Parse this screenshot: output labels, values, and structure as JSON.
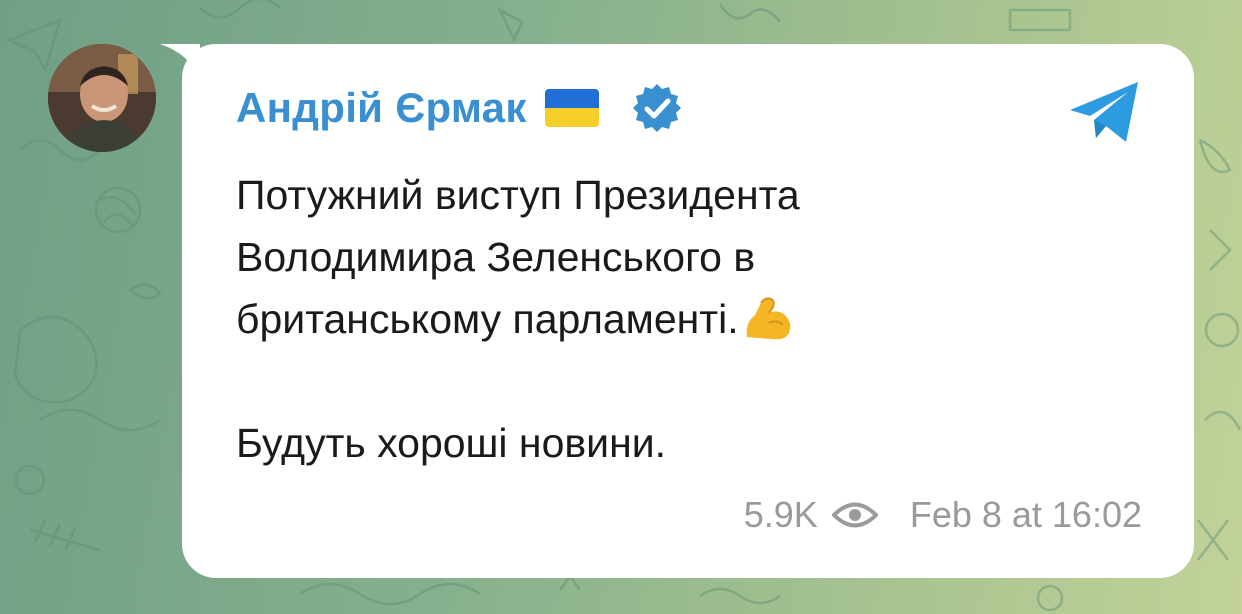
{
  "post": {
    "sender_name": "Андрій Єрмак",
    "flag_icon": "ukraine-flag-icon",
    "verified_icon": "verified-badge-icon",
    "app_icon": "telegram-icon",
    "message_lines": [
      "Потужний виступ Президента",
      "Володимира Зеленського в",
      "британському парламенті."
    ],
    "message_emoji": "flexed-biceps-icon",
    "message_closing": "Будуть хороші новини.",
    "views": "5.9K",
    "views_icon": "eye-icon",
    "timestamp": "Feb 8 at 16:02"
  },
  "colors": {
    "sender_name": "#3a8fd1",
    "telegram": "#2d9be0",
    "flag_blue": "#1f6fd6",
    "flag_yellow": "#f6cf2a",
    "meta_text": "#9a9a9a"
  }
}
